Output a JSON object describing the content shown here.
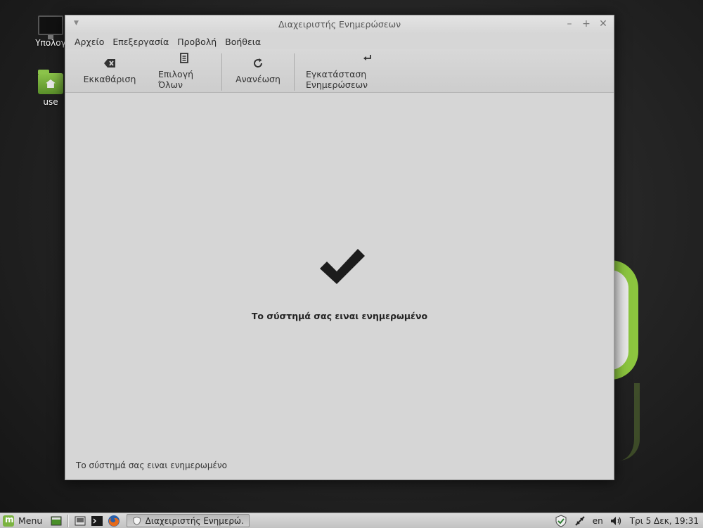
{
  "desktop": {
    "icons": [
      {
        "label": "Υπολογ",
        "icon": "computer-icon"
      },
      {
        "label": "use",
        "icon": "home-folder-icon"
      }
    ]
  },
  "window": {
    "title": "Διαχειριστής Ενημερώσεων",
    "menu": [
      "Αρχείο",
      "Επεξεργασία",
      "Προβολή",
      "Βοήθεια"
    ],
    "toolbar": [
      {
        "label": "Εκκαθάριση",
        "icon": "clear-icon"
      },
      {
        "label": "Επιλογή Όλων",
        "icon": "select-all-icon"
      },
      {
        "label": "Ανανέωση",
        "icon": "refresh-icon"
      },
      {
        "label": "Εγκατάσταση Ενημερώσεων",
        "icon": "install-updates-icon"
      }
    ],
    "status_main": "Το σύστημά σας ειναι ενημερωμένο",
    "status_bar": "Το σύστημά σας ειναι ενημερωμένο"
  },
  "taskbar": {
    "menu_label": "Menu",
    "task_label": "Διαχειριστής Ενημερώ...",
    "keyboard_layout": "en",
    "clock": "Τρι  5 Δεκ, 19:31"
  },
  "colors": {
    "accent": "#8cc63f",
    "window_bg": "#d6d6d6"
  }
}
